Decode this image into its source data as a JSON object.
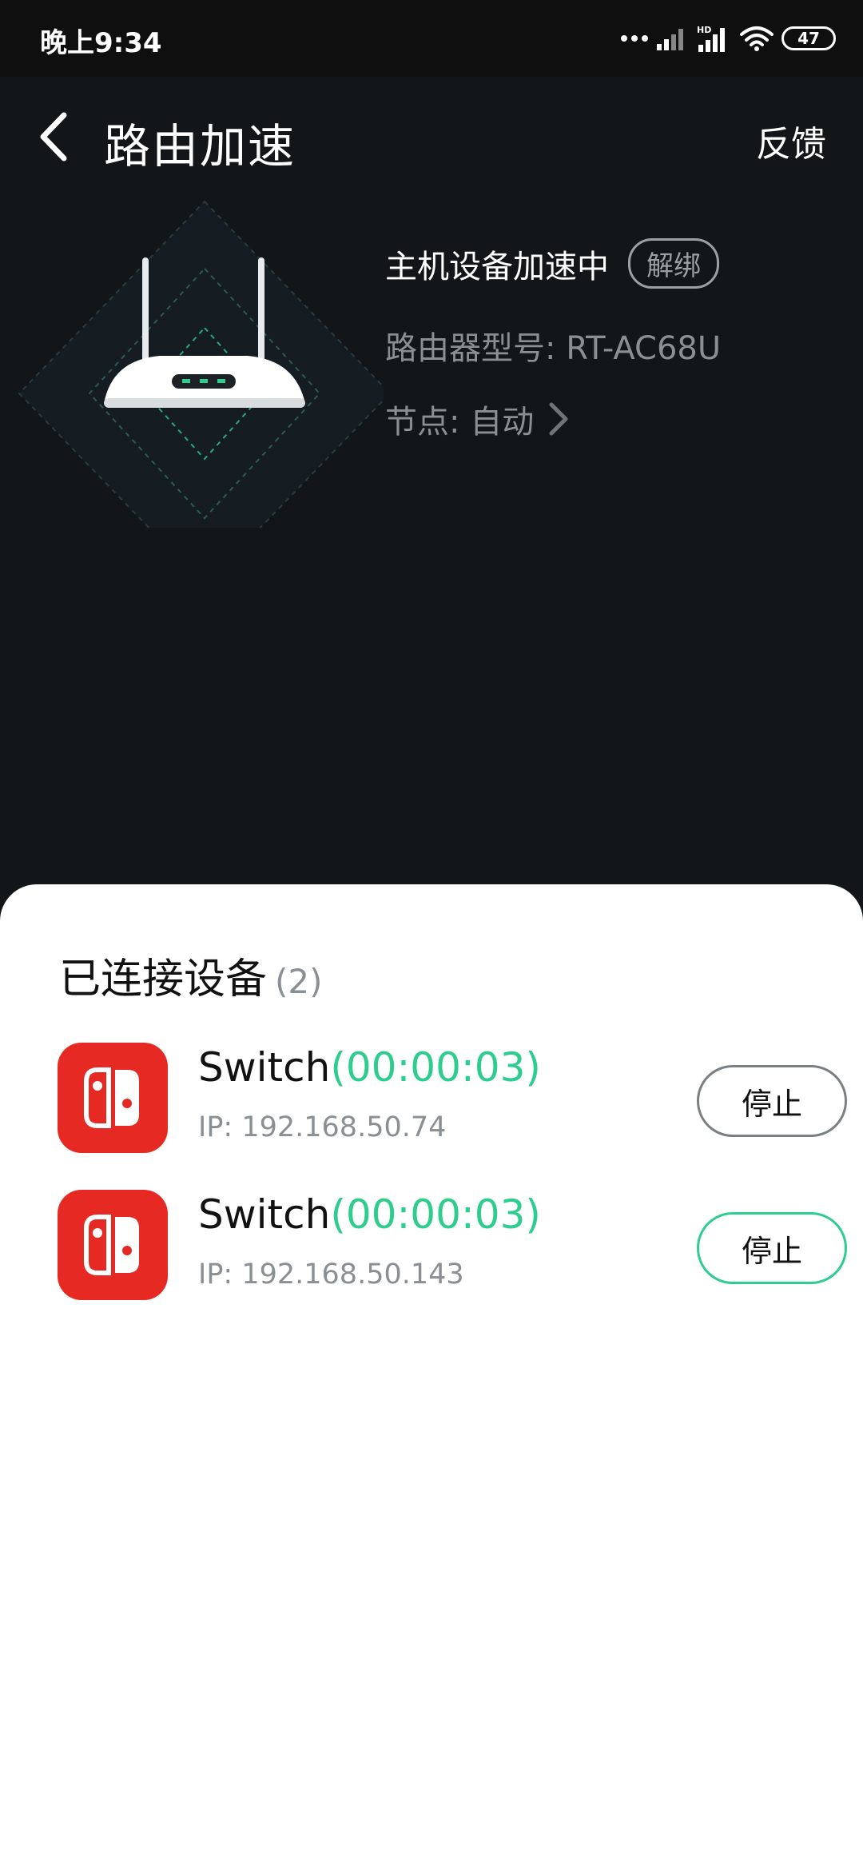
{
  "status_bar": {
    "time": "晚上9:34",
    "battery": "47",
    "icons": [
      "more-dots-icon",
      "signal-icon",
      "hd-signal-icon",
      "wifi-icon",
      "battery-icon"
    ]
  },
  "app_bar": {
    "title": "路由加速",
    "feedback_label": "反馈",
    "back_icon": "back-arrow-icon"
  },
  "router": {
    "status_text": "主机设备加速中",
    "unbind_label": "解绑",
    "model_text": "路由器型号:  RT-AC68U",
    "node_text": "节点: 自动",
    "node_icon": "chevron-right-icon"
  },
  "connected": {
    "title": "已连接设备",
    "count": "(2)",
    "devices": [
      {
        "name": "Switch",
        "duration": "(00:00:03)",
        "ip": "IP: 192.168.50.74",
        "stop_label": "停止",
        "icon": "nintendo-switch-icon"
      },
      {
        "name": "Switch",
        "duration": "(00:00:03)",
        "ip": "IP: 192.168.50.143",
        "stop_label": "停止",
        "icon": "nintendo-switch-icon"
      }
    ]
  },
  "colors": {
    "accent_green": "#2ecc8f",
    "switch_red": "#e62a23",
    "dark_bg": "#121619"
  }
}
